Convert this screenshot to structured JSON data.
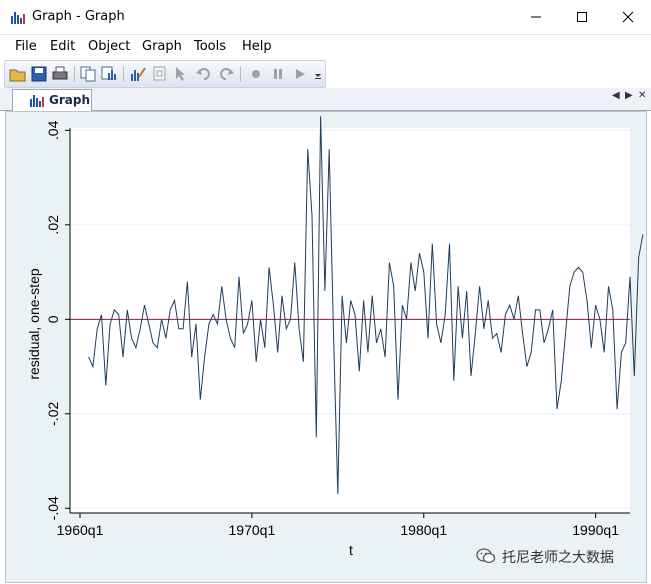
{
  "window": {
    "title": "Graph - Graph",
    "controls": {
      "minimize": "minimize",
      "maximize": "maximize",
      "close": "close"
    }
  },
  "menu": [
    "File",
    "Edit",
    "Object",
    "Graph",
    "Tools",
    "Help"
  ],
  "toolbar": {
    "icons": [
      "open-icon",
      "save-icon",
      "print-icon",
      "copy-icon",
      "copy-graph-icon",
      "graph-editor-icon",
      "recorder-icon",
      "pointer-icon",
      "undo-icon",
      "redo-icon",
      "record-icon",
      "pause-icon",
      "play-icon"
    ]
  },
  "tab": {
    "label": "Graph"
  },
  "chart_data": {
    "type": "line",
    "xlabel": "t",
    "ylabel": "residual, one-step",
    "x_ticks": [
      "1960q1",
      "1970q1",
      "1980q1",
      "1990q1"
    ],
    "y_ticks": [
      "-.04",
      "-.02",
      "0",
      ".02",
      ".04"
    ],
    "y_tick_values": [
      -0.04,
      -0.02,
      0,
      0.02,
      0.04
    ],
    "ylim": [
      -0.041,
      0.0405
    ],
    "xlim": [
      "1960q1",
      "1991q4"
    ],
    "reference_line": {
      "y": 0,
      "color": "#8b1a4a"
    },
    "series_color": "#1f3d5c",
    "x_start": "1960q3",
    "x_end": "1990q4",
    "values": [
      -0.008,
      -0.01,
      -0.002,
      0.001,
      -0.014,
      -0.001,
      0.002,
      0.001,
      -0.008,
      0.002,
      -0.004,
      -0.006,
      -0.002,
      0.003,
      -0.001,
      -0.005,
      -0.006,
      0.0,
      -0.004,
      0.002,
      0.004,
      -0.002,
      -0.002,
      0.008,
      -0.008,
      -0.001,
      -0.017,
      -0.008,
      -0.001,
      0.001,
      -0.001,
      0.007,
      0.0,
      -0.004,
      -0.006,
      0.009,
      -0.003,
      -0.001,
      0.004,
      -0.009,
      0.0,
      -0.006,
      0.011,
      0.003,
      -0.007,
      0.005,
      -0.002,
      0.0,
      0.012,
      -0.002,
      -0.009,
      0.036,
      0.022,
      -0.025,
      0.043,
      0.006,
      0.036,
      -0.003,
      -0.037,
      0.005,
      -0.005,
      0.004,
      0.001,
      -0.011,
      0.004,
      -0.007,
      0.005,
      -0.005,
      -0.002,
      -0.008,
      0.012,
      0.007,
      -0.017,
      0.003,
      0.0,
      0.012,
      0.006,
      0.014,
      0.01,
      -0.004,
      0.016,
      -0.001,
      -0.005,
      0.001,
      0.016,
      -0.013,
      0.007,
      -0.004,
      0.006,
      -0.012,
      -0.003,
      0.007,
      -0.002,
      0.004,
      -0.004,
      -0.003,
      -0.007,
      0.001,
      0.003,
      0.0,
      0.005,
      -0.003,
      -0.01,
      -0.007,
      0.002,
      0.002,
      -0.005,
      -0.002,
      0.002,
      -0.019,
      -0.013,
      -0.003,
      0.007,
      0.01,
      0.011,
      0.01,
      0.004,
      -0.006,
      0.003,
      0.0,
      -0.007,
      0.007,
      0.002,
      -0.019,
      -0.007,
      -0.005,
      0.009,
      -0.012,
      0.013,
      0.018
    ]
  },
  "watermark": {
    "text": "托尼老师之大数据"
  }
}
